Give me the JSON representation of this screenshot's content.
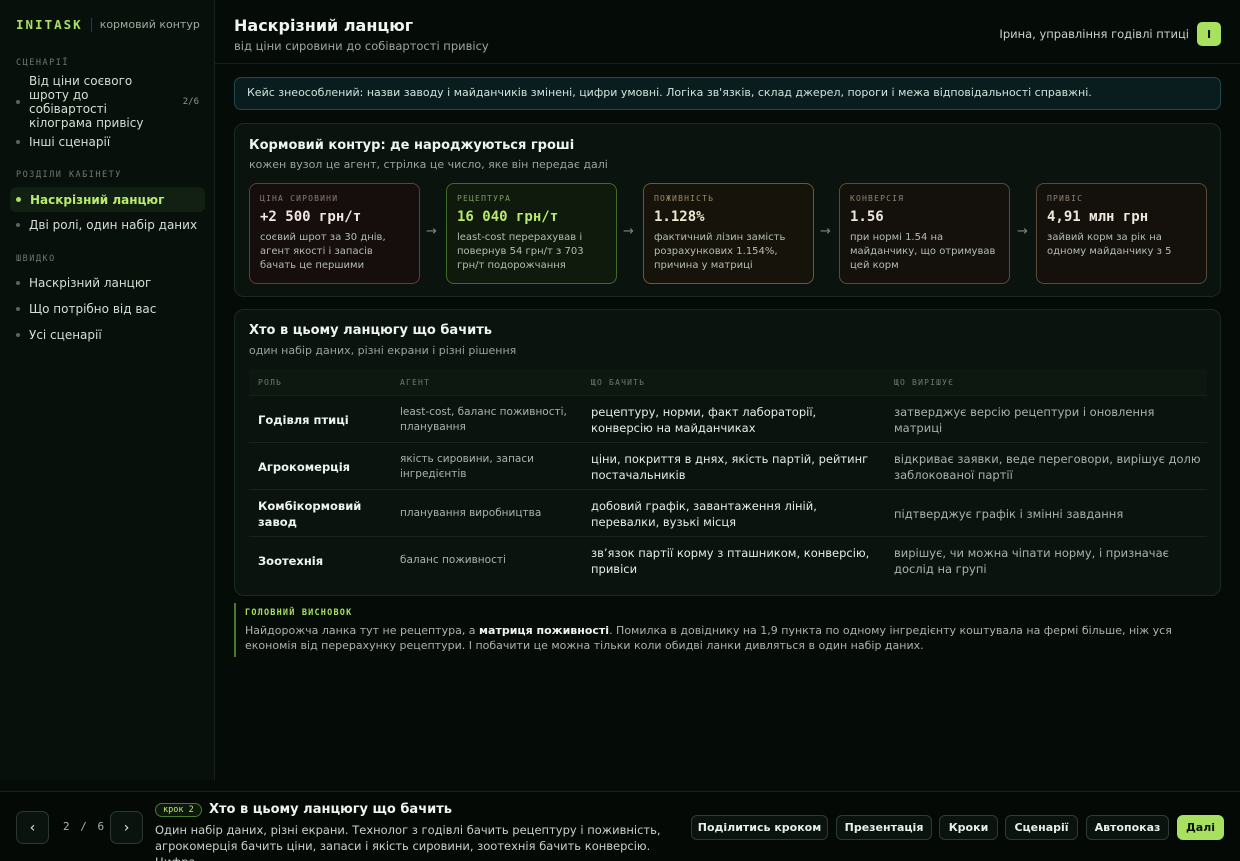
{
  "brand": {
    "logo": "INITASK",
    "subtitle": "кормовий контур"
  },
  "sidebar": {
    "sections": {
      "scenarios": "СЦЕНАРІЇ",
      "cabinet": "РОЗДІЛИ КАБІНЕТУ",
      "quick": "ШВИДКО"
    },
    "scenarios": [
      {
        "label": "Від ціни соєвого шроту до собівартості кілограма привісу",
        "count": "2/6"
      },
      {
        "label": "Інші сценарії"
      }
    ],
    "cabinet": [
      {
        "label": "Наскрізний ланцюг",
        "active": true
      },
      {
        "label": "Дві ролі, один набір даних"
      }
    ],
    "quick": [
      {
        "label": "Наскрізний ланцюг"
      },
      {
        "label": "Що потрібно від вас"
      },
      {
        "label": "Усі сценарії"
      }
    ]
  },
  "header": {
    "title": "Наскрізний ланцюг",
    "subtitle": "від ціни сировини до собівартості привісу",
    "user_name": "Ірина, управління годівлі птиці",
    "avatar": "І"
  },
  "notice": "Кейс знеособлений: назви заводу і майданчиків змінені, цифри умовні. Логіка зв'язків, склад джерел, пороги і межа відповідальності справжні.",
  "chain_card": {
    "title": "Кормовий контур: де народжуються гроші",
    "subtitle": "кожен вузол це агент, стрілка це число, яке він передає далі",
    "arrow": "→",
    "nodes": [
      {
        "label": "ЦІНА СИРОВИНИ",
        "value": "+2 500 грн/т",
        "desc": "соєвий шрот за 30 днів, агент якості і запасів бачать це першими"
      },
      {
        "label": "РЕЦЕПТУРА",
        "value": "16 040 грн/т",
        "desc": "least-cost перерахував і повернув 54 грн/т з 703 грн/т подорожчання"
      },
      {
        "label": "ПОЖИВНІСТЬ",
        "value": "1.128%",
        "desc": "фактичний лізин замість розрахункових 1.154%, причина у матриці"
      },
      {
        "label": "КОНВЕРСІЯ",
        "value": "1.56",
        "desc": "при нормі 1.54 на майданчику, що отримував цей корм"
      },
      {
        "label": "ПРИВІС",
        "value": "4,91 млн грн",
        "desc": "зайвий корм за рік на одному майданчику з 5"
      }
    ]
  },
  "roles_card": {
    "title": "Хто в цьому ланцюгу що бачить",
    "subtitle": "один набір даних, різні екрани і різні рішення",
    "columns": {
      "role": "РОЛЬ",
      "agent": "АГЕНТ",
      "sees": "ЩО БАЧИТЬ",
      "decides": "ЩО ВИРІШУЄ"
    },
    "rows": [
      {
        "role": "Годівля птиці",
        "agent": "least-cost, баланс поживності, планування",
        "sees": "рецептуру, норми, факт лабораторії, конверсію на майданчиках",
        "decides": "затверджує версію рецептури і оновлення матриці"
      },
      {
        "role": "Агрокомерція",
        "agent": "якість сировини, запаси інгредієнтів",
        "sees": "ціни, покриття в днях, якість партій, рейтинг постачальників",
        "decides": "відкриває заявки, веде переговори, вирішує долю заблокованої партії"
      },
      {
        "role": "Комбікормовий завод",
        "agent": "планування виробництва",
        "sees": "добовий графік, завантаження ліній, перевалки, вузькі місця",
        "decides": "підтверджує графік і змінні завдання"
      },
      {
        "role": "Зоотехнія",
        "agent": "баланс поживності",
        "sees": "зв’язок партії корму з пташником, конверсію, привіси",
        "decides": "вирішує, чи можна чіпати норму, і призначає дослід на групі"
      }
    ]
  },
  "conclusion": {
    "label": "ГОЛОВНИЙ ВИСНОВОК",
    "text_before": "Найдорожча ланка тут не рецептура, а ",
    "text_bold": "матриця поживності",
    "text_after": ". Помилка в довіднику на 1,9 пункта по одному інгредієнту коштувала на фермі більше, ніж уся економія від перерахунку рецептури. І побачити це можна тільки коли обидві ланки дивляться в один набір даних."
  },
  "footer": {
    "prev": "‹",
    "next": "›",
    "page_current": "2",
    "page_sep": "/",
    "page_total": "6",
    "step_badge": "крок 2",
    "step_title": "Хто в цьому ланцюгу що бачить",
    "step_desc": "Один набір даних, різні екрани. Технолог з годівлі бачить рецептуру і поживність, агрокомерція бачить ціни, запаси і якість сировини, зоотехнія бачить конверсію. Цифра...",
    "buttons": {
      "share": "Поділитись кроком",
      "present": "Презентація",
      "steps": "Кроки",
      "scenarios": "Сценарії",
      "autoplay": "Автопоказ",
      "next": "Далі"
    }
  },
  "colors": {
    "accent": "#a8e05f",
    "background": "#050b07",
    "notice_border": "#1f4a4a"
  }
}
